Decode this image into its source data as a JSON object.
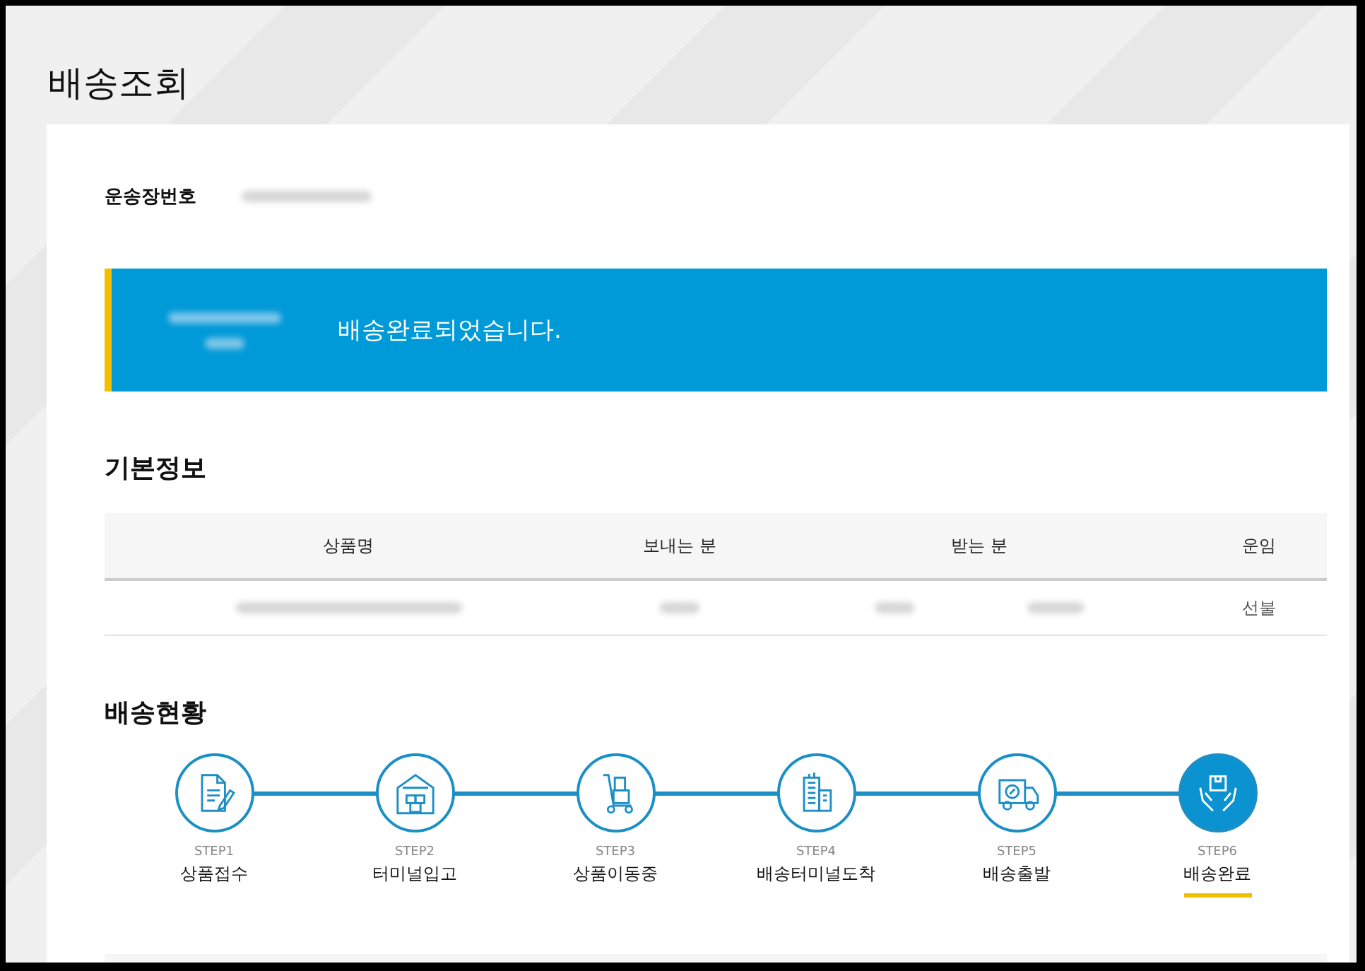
{
  "page_title": "배송조회",
  "waybill": {
    "label": "운송장번호"
  },
  "banner": {
    "message": "배송완료되었습니다."
  },
  "basic_info": {
    "heading": "기본정보",
    "columns": [
      "상품명",
      "보내는 분",
      "받는 분",
      "운임"
    ],
    "fare": "선불"
  },
  "delivery_status": {
    "heading": "배송현황",
    "steps": [
      {
        "step": "STEP1",
        "label": "상품접수",
        "kind": "document",
        "selected": false
      },
      {
        "step": "STEP2",
        "label": "터미널입고",
        "kind": "warehouse",
        "selected": false
      },
      {
        "step": "STEP3",
        "label": "상품이동중",
        "kind": "cart",
        "selected": false
      },
      {
        "step": "STEP4",
        "label": "배송터미널도착",
        "kind": "building",
        "selected": false
      },
      {
        "step": "STEP5",
        "label": "배송출발",
        "kind": "truck",
        "selected": false
      },
      {
        "step": "STEP6",
        "label": "배송완료",
        "kind": "hands",
        "selected": true
      }
    ]
  }
}
